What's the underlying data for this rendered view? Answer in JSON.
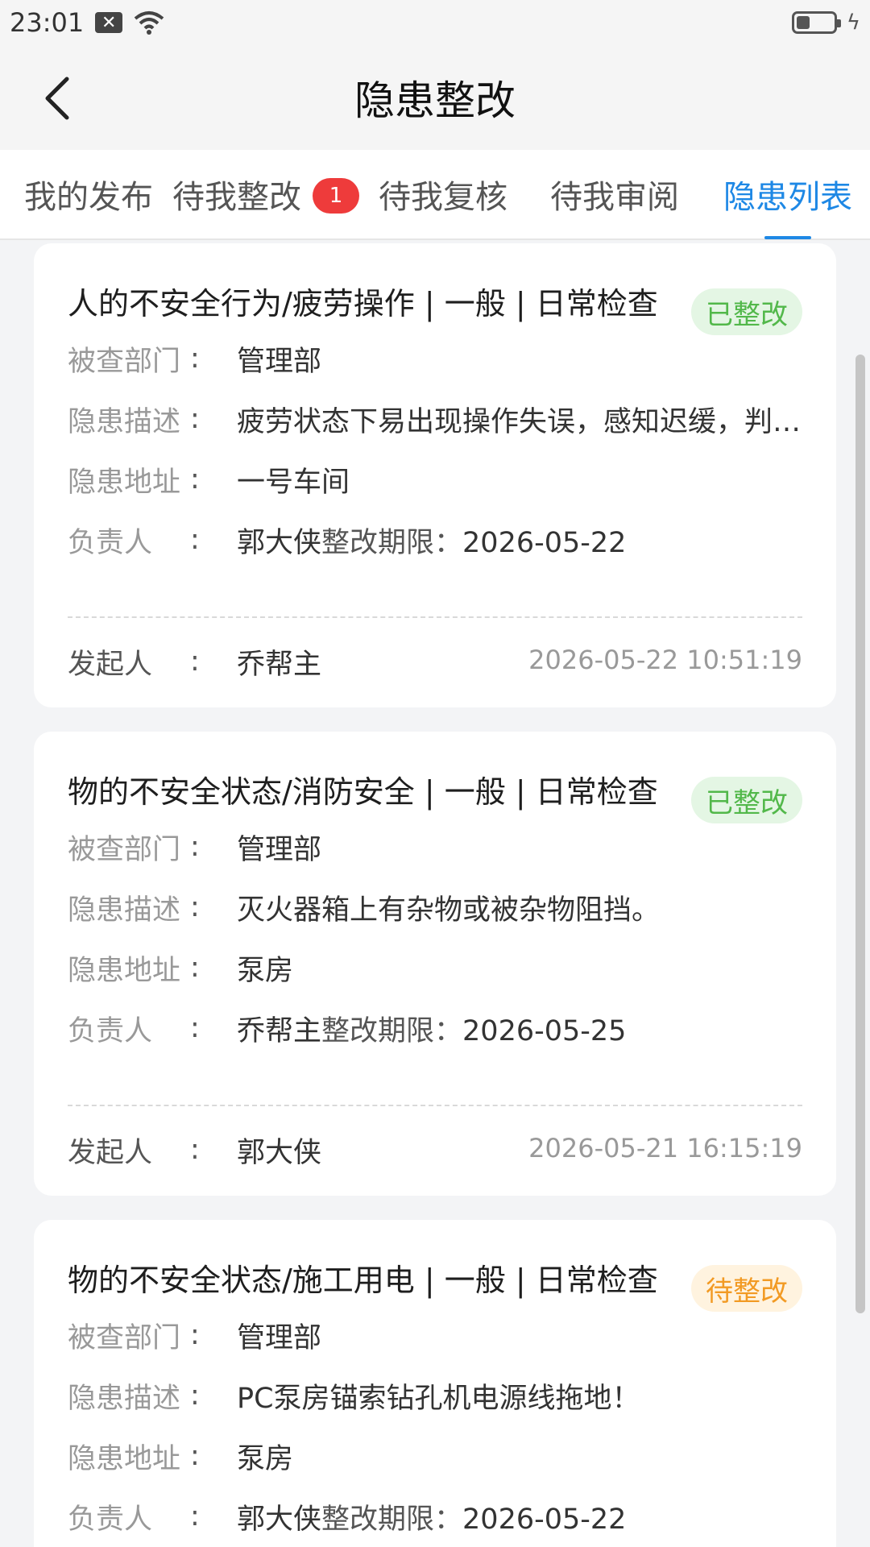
{
  "status_bar": {
    "time": "23:01"
  },
  "header": {
    "title": "隐患整改"
  },
  "tabs": [
    {
      "label": "我的发布"
    },
    {
      "label": "待我整改",
      "badge": "1"
    },
    {
      "label": "待我复核"
    },
    {
      "label": "待我审阅"
    },
    {
      "label": "隐患列表",
      "active": true
    }
  ],
  "labels": {
    "dept": "被查部门",
    "desc": "隐患描述",
    "addr": "隐患地址",
    "owner": "负责人",
    "deadline": "整改期限：",
    "initiator": "发起人",
    "colon": ":"
  },
  "cards": [
    {
      "title": "人的不安全行为/疲劳操作 | 一般 | 日常检查",
      "status": "已整改",
      "dept": "管理部",
      "desc": "疲劳状态下易出现操作失误，感知迟缓，判…",
      "addr": "一号车间",
      "owner": "郭大侠",
      "deadline": "2026-05-22",
      "initiator": "乔帮主",
      "time": "2026-05-22 10:51:19"
    },
    {
      "title": "物的不安全状态/消防安全 | 一般 | 日常检查",
      "status": "已整改",
      "dept": "管理部",
      "desc": "灭火器箱上有杂物或被杂物阻挡。",
      "addr": "泵房",
      "owner": "乔帮主",
      "deadline": "2026-05-25",
      "initiator": "郭大侠",
      "time": "2026-05-21 16:15:19"
    },
    {
      "title": "物的不安全状态/施工用电 | 一般 | 日常检查",
      "status": "待整改",
      "dept": "管理部",
      "desc": "PC泵房锚索钻孔机电源线拖地！",
      "addr": "泵房",
      "owner": "郭大侠",
      "deadline": "2026-05-22"
    }
  ],
  "colors": {
    "accent": "#1e88e5",
    "done": "#52b84a",
    "pending": "#f29a23",
    "badge": "#ee3b3b"
  }
}
